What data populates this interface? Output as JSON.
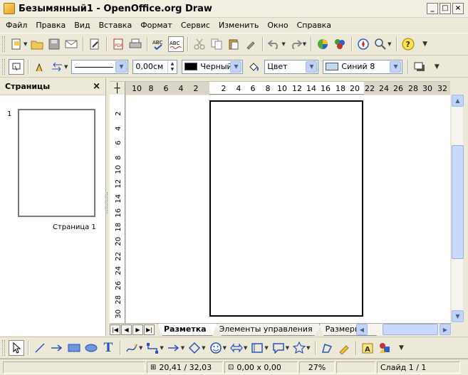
{
  "window": {
    "title": "Безымянный1 - OpenOffice.org Draw",
    "buttons": {
      "minimize": "_",
      "maximize": "□",
      "close": "×"
    }
  },
  "menu": [
    "Файл",
    "Правка",
    "Вид",
    "Вставка",
    "Формат",
    "Сервис",
    "Изменить",
    "Окно",
    "Справка"
  ],
  "line_toolbar": {
    "line_width": "0,00см",
    "line_color": "Черный",
    "line_color_hex": "#000000",
    "area_style": "Цвет",
    "area_color": "Синий 8",
    "area_color_hex": "#bed8f2"
  },
  "pages_pane": {
    "title": "Страницы",
    "close": "×",
    "thumb_number": "1",
    "thumb_label": "Страница 1"
  },
  "ruler_h": {
    "left": [
      "10",
      "8",
      "6",
      "4",
      "2"
    ],
    "center": [
      "2",
      "4",
      "6",
      "8",
      "10",
      "12",
      "14",
      "16",
      "18",
      "20"
    ],
    "right": [
      "22",
      "24",
      "26",
      "28",
      "30",
      "32"
    ]
  },
  "ruler_v": [
    "2",
    "4",
    "6",
    "8",
    "10",
    "12",
    "14",
    "16",
    "18",
    "20",
    "22",
    "24",
    "26",
    "28",
    "30"
  ],
  "tabs": [
    {
      "label": "Разметка",
      "active": true
    },
    {
      "label": "Элементы управления",
      "active": false
    },
    {
      "label": "Размерные",
      "active": false
    }
  ],
  "status": {
    "position": "20,41 / 32,03",
    "size": "0,00 x 0,00",
    "zoom": "27%",
    "slide": "Слайд 1 / 1"
  }
}
